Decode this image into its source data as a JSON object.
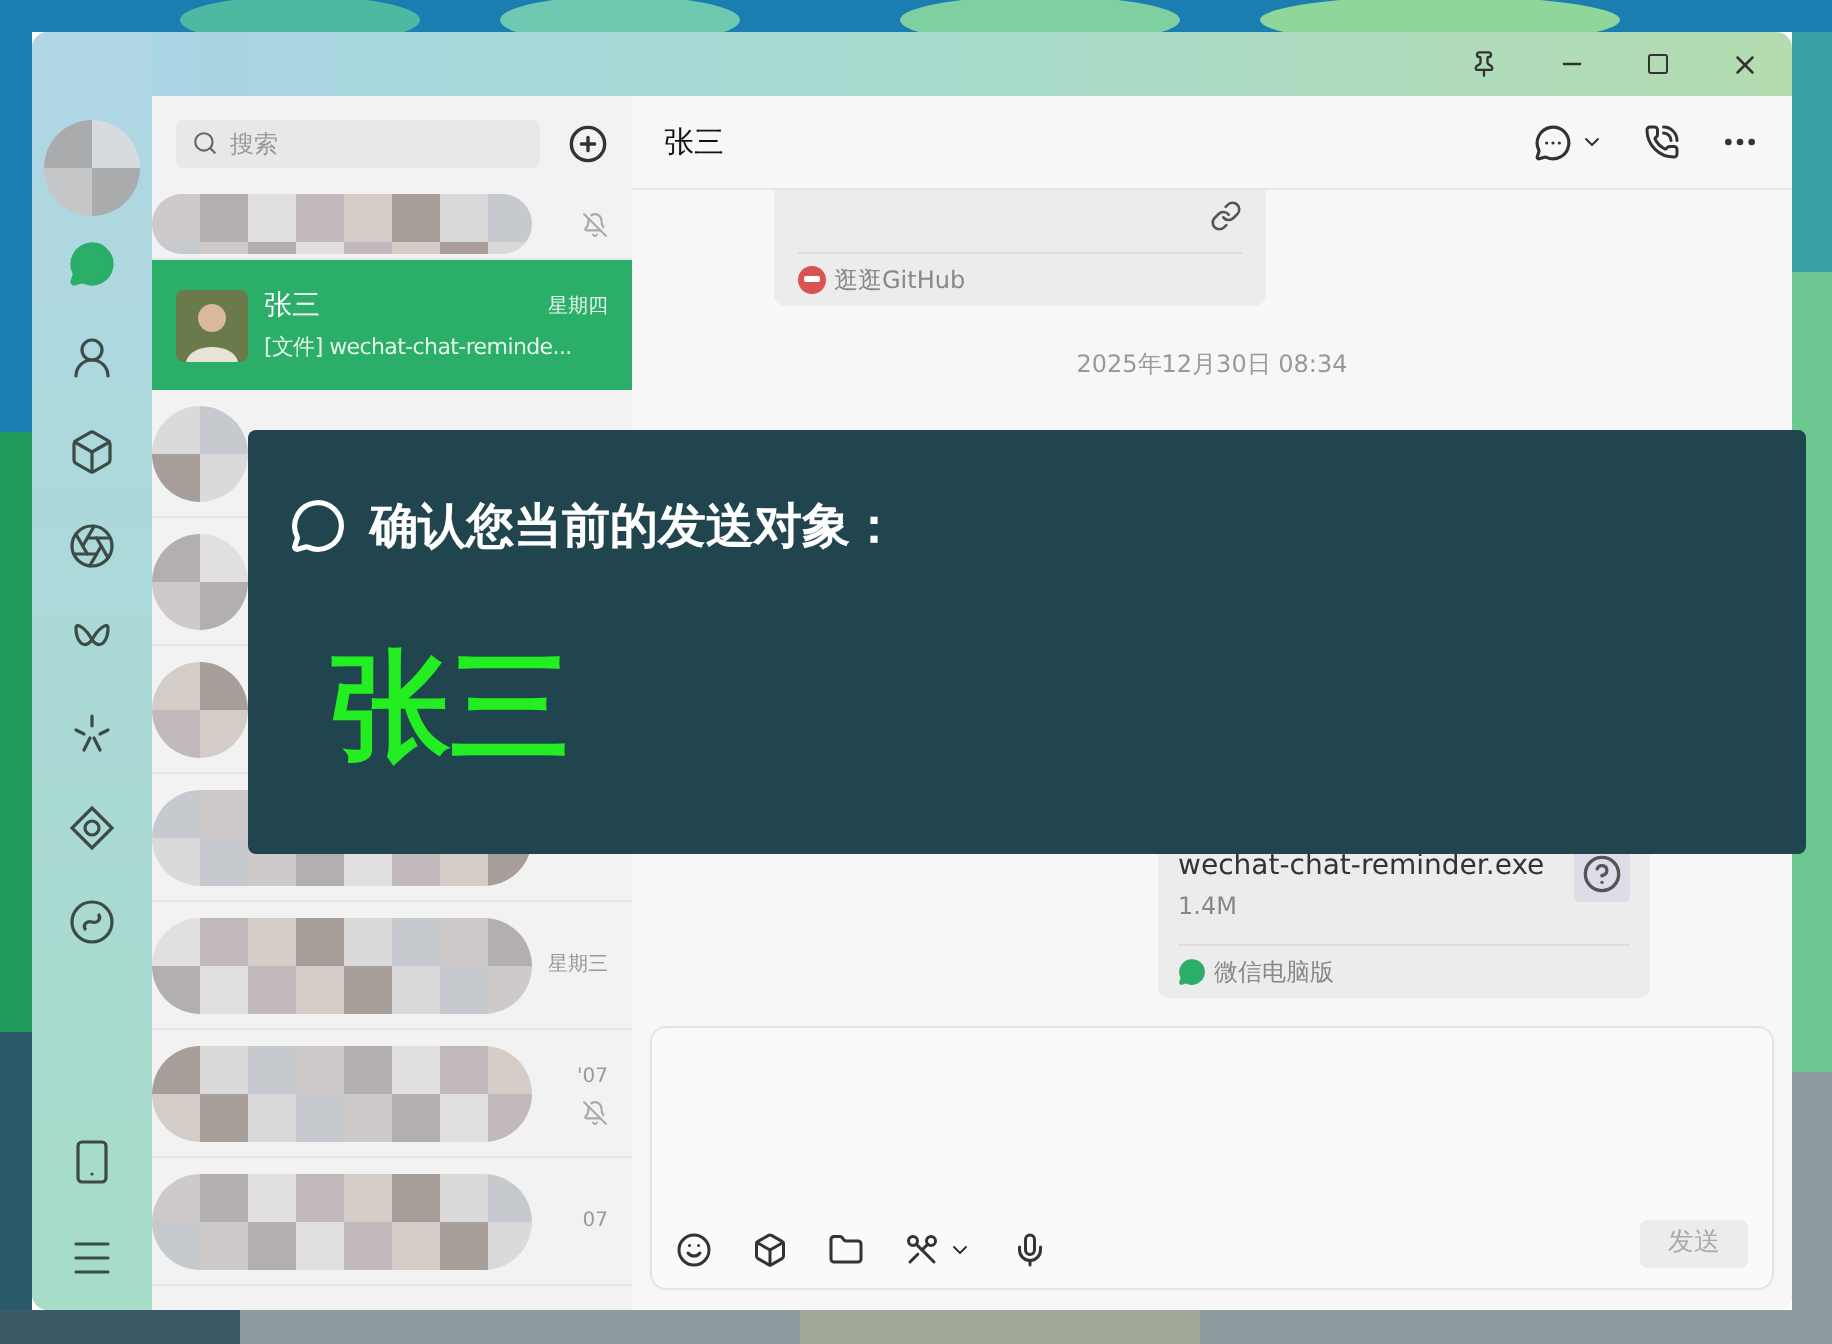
{
  "sidebar": {
    "items": [
      {
        "kind": "chat",
        "selected": true
      },
      {
        "kind": "contacts",
        "selected": false
      },
      {
        "kind": "favorites",
        "selected": false
      },
      {
        "kind": "moments",
        "selected": false
      },
      {
        "kind": "channels",
        "selected": false
      },
      {
        "kind": "search",
        "selected": false
      },
      {
        "kind": "games",
        "selected": false
      },
      {
        "kind": "miniapps",
        "selected": false
      }
    ],
    "bottom": [
      {
        "kind": "phone",
        "selected": false
      },
      {
        "kind": "menu",
        "selected": false
      }
    ]
  },
  "chat_list": {
    "search": {
      "placeholder": "搜索"
    },
    "items": [
      {
        "kind": "hidden",
        "muted": true,
        "selected": false
      },
      {
        "kind": "contact",
        "name": "张三",
        "time": "星期四",
        "preview": "[文件] wechat-chat-reminde...",
        "selected": true
      },
      {
        "kind": "hidden",
        "selected": false
      },
      {
        "kind": "hidden",
        "selected": false
      },
      {
        "kind": "hidden",
        "selected": false
      },
      {
        "kind": "hidden",
        "selected": false
      },
      {
        "kind": "hidden",
        "time": "星期三",
        "selected": false
      },
      {
        "kind": "hidden",
        "time": "'07",
        "muted": true,
        "selected": false
      },
      {
        "kind": "hidden",
        "time": "07",
        "selected": false
      }
    ]
  },
  "chat": {
    "title": "张三",
    "messages": [
      {
        "kind": "link_card",
        "source": "逛逛GitHub"
      },
      {
        "kind": "timestamp",
        "text": "2025年12月30日 08:34"
      },
      {
        "kind": "file",
        "name": "wechat-chat-reminder.exe",
        "size": "1.4M",
        "source": "微信电脑版"
      }
    ],
    "send_button": {
      "label": "发送",
      "disabled": true
    }
  },
  "overlay": {
    "title": "确认您当前的发送对象：",
    "target": "张三"
  }
}
